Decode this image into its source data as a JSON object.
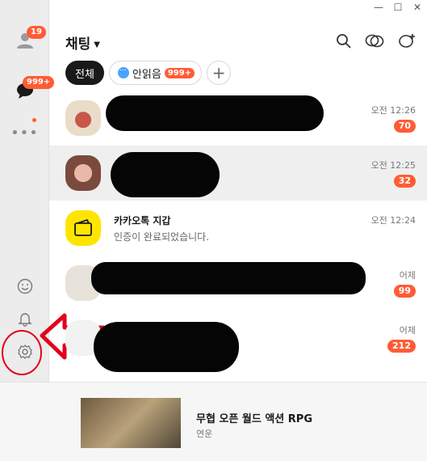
{
  "window": {
    "controls": [
      "—",
      "☐",
      "✕"
    ]
  },
  "rail": {
    "friends_badge": "19",
    "chats_badge": "999+"
  },
  "header": {
    "title": "채팅"
  },
  "filters": {
    "all": "전체",
    "unread": "안읽음",
    "unread_badge": "999+"
  },
  "chats": [
    {
      "name": "",
      "message": "",
      "time": "오전 12:26",
      "badge": "70"
    },
    {
      "name": "",
      "message": "",
      "time": "오전 12:25",
      "badge": "32"
    },
    {
      "name": "카카오톡 지갑",
      "message": "인증이 완료되었습니다.",
      "time": "오전 12:24",
      "badge": ""
    },
    {
      "name": "",
      "message": "",
      "time": "어제",
      "badge": "99"
    },
    {
      "name": "",
      "message": "",
      "time": "어제",
      "badge": "212"
    }
  ],
  "ad": {
    "title": "무협 오픈 월드 액션 RPG",
    "subtitle": "연운"
  },
  "colors": {
    "accent": "#ff5c35",
    "wallet": "#fee500",
    "annotation": "#e3001b"
  }
}
